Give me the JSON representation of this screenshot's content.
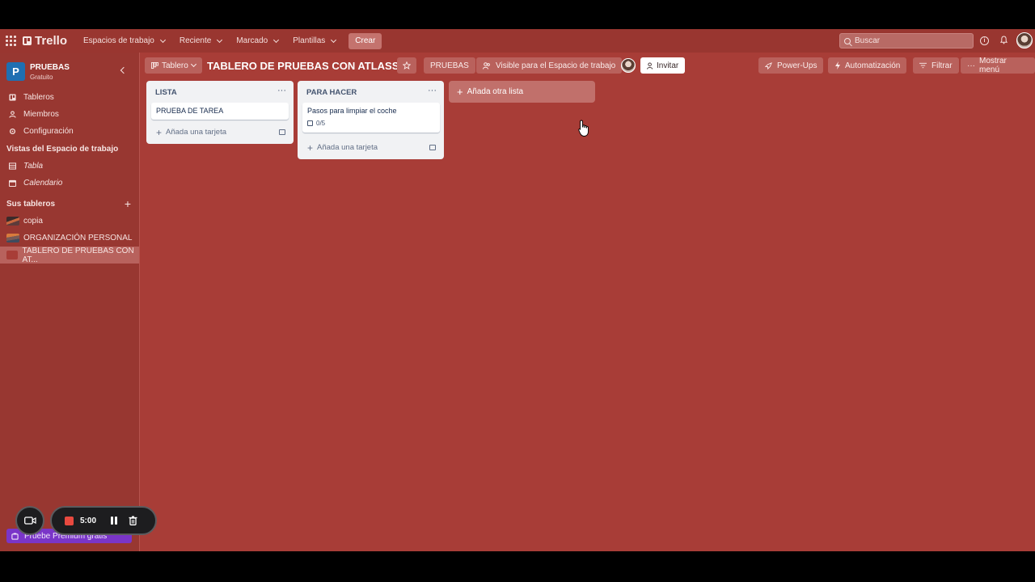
{
  "nav": {
    "logo": "Trello",
    "menus": [
      "Espacios de trabajo",
      "Reciente",
      "Marcado",
      "Plantillas"
    ],
    "create_label": "Crear",
    "search_placeholder": "Buscar"
  },
  "sidebar": {
    "workspace_initial": "P",
    "workspace_name": "PRUEBAS",
    "workspace_plan": "Gratuito",
    "items": [
      "Tableros",
      "Miembros",
      "Configuración"
    ],
    "views_title": "Vistas del Espacio de trabajo",
    "views": [
      "Tabla",
      "Calendario"
    ],
    "boards_title": "Sus tableros",
    "boards": [
      "copia",
      "ORGANIZACIÓN PERSONAL",
      "TABLERO DE PRUEBAS CON AT..."
    ],
    "premium_label": "Pruebe Premium gratis"
  },
  "board": {
    "view_label": "Tablero",
    "title": "TABLERO DE PRUEBAS CON ATLASSIAN",
    "workspace_label": "PRUEBAS",
    "visibility_label": "Visible para el Espacio de trabajo",
    "invite_label": "Invitar",
    "powerups_label": "Power-Ups",
    "automation_label": "Automatización",
    "filter_label": "Filtrar",
    "menu_label": "Mostrar menú",
    "add_list_label": "Añada otra lista"
  },
  "lists": [
    {
      "title": "LISTA",
      "menu": "···",
      "cards": [
        {
          "title": "PRUEBA DE TAREA"
        }
      ],
      "add_card_label": "Añada una tarjeta"
    },
    {
      "title": "PARA HACER",
      "menu": "···",
      "cards": [
        {
          "title": "Pasos para limpiar el coche",
          "checklist": "0/5"
        }
      ],
      "add_card_label": "Añada una tarjeta"
    }
  ],
  "recorder": {
    "time": "5:00"
  },
  "colors": {
    "board_bg": "#a83d37",
    "nav_bg": "#993630",
    "workspace_avatar": "#1f6fb2",
    "premium": "#7a35c8"
  }
}
